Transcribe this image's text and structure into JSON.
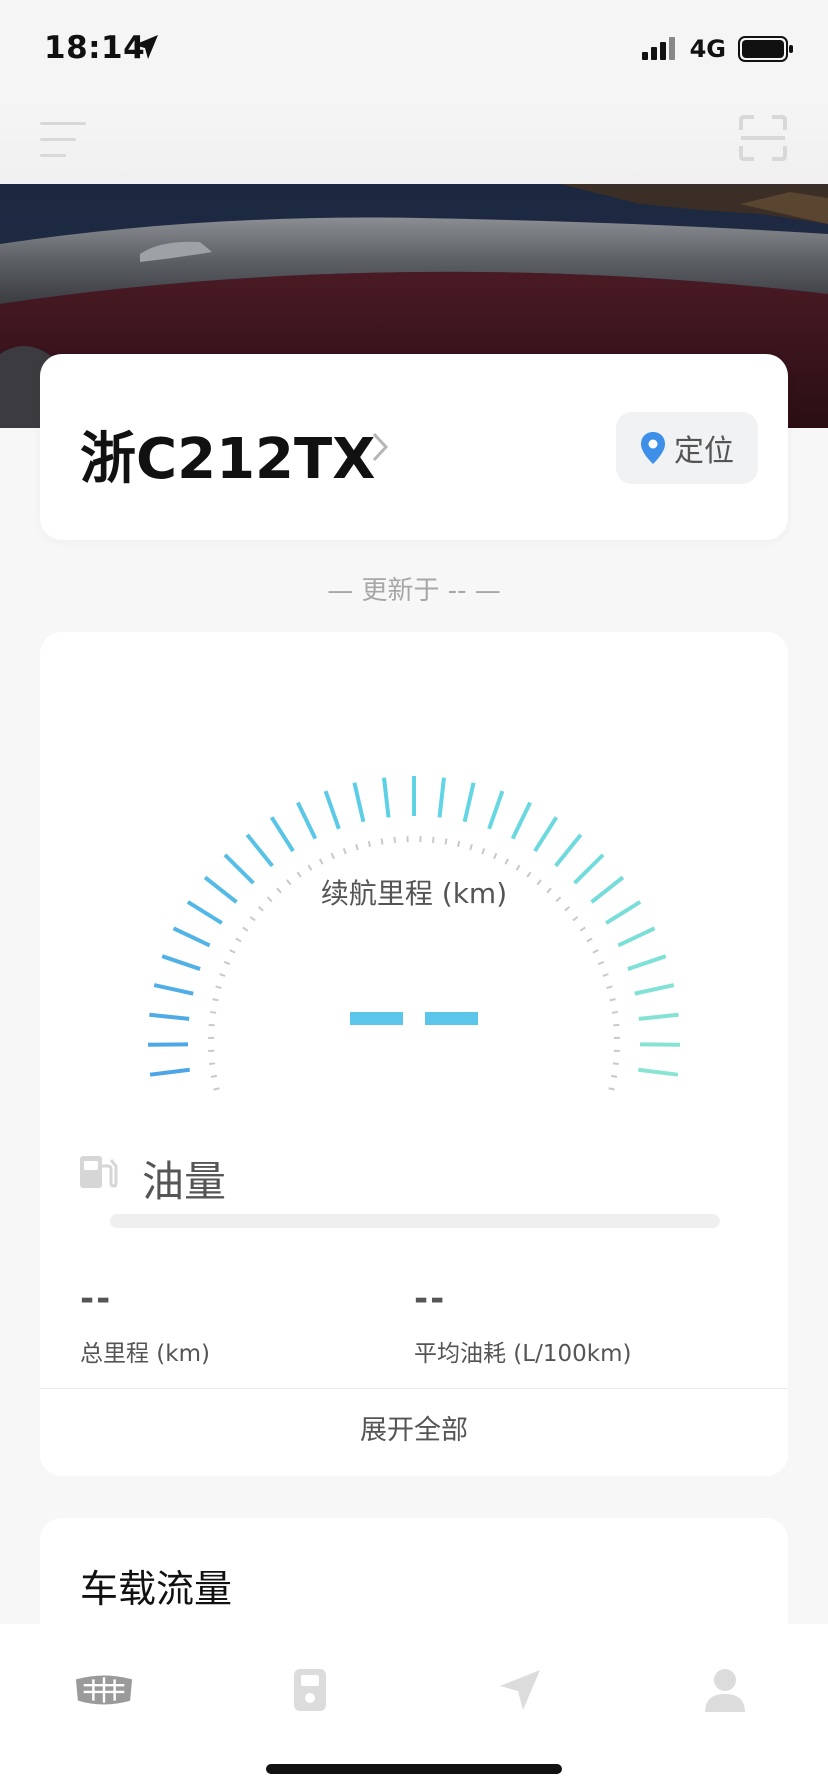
{
  "status_bar": {
    "time": "18:14",
    "network": "4G"
  },
  "vehicle": {
    "plate": "浙C212TX",
    "locate_label": "定位"
  },
  "update_text": "— 更新于 -- —",
  "range": {
    "label": "续航里程 (km)",
    "value": "--"
  },
  "fuel": {
    "label": "油量",
    "level_percent": 0
  },
  "metrics": [
    {
      "value": "--",
      "label": "总里程 (km)"
    },
    {
      "value": "--",
      "label": "平均油耗 (L/100km)"
    }
  ],
  "expand_label": "展开全部",
  "traffic_title": "车载流量",
  "colors": {
    "gauge_start": "#4a9fe6",
    "gauge_end": "#8fe7cf",
    "accent": "#5cc6ea",
    "locate_pin": "#3d8fe8"
  },
  "tabs": [
    {
      "icon": "car-brand-icon"
    },
    {
      "icon": "device-icon"
    },
    {
      "icon": "navigation-icon"
    },
    {
      "icon": "profile-icon"
    }
  ]
}
